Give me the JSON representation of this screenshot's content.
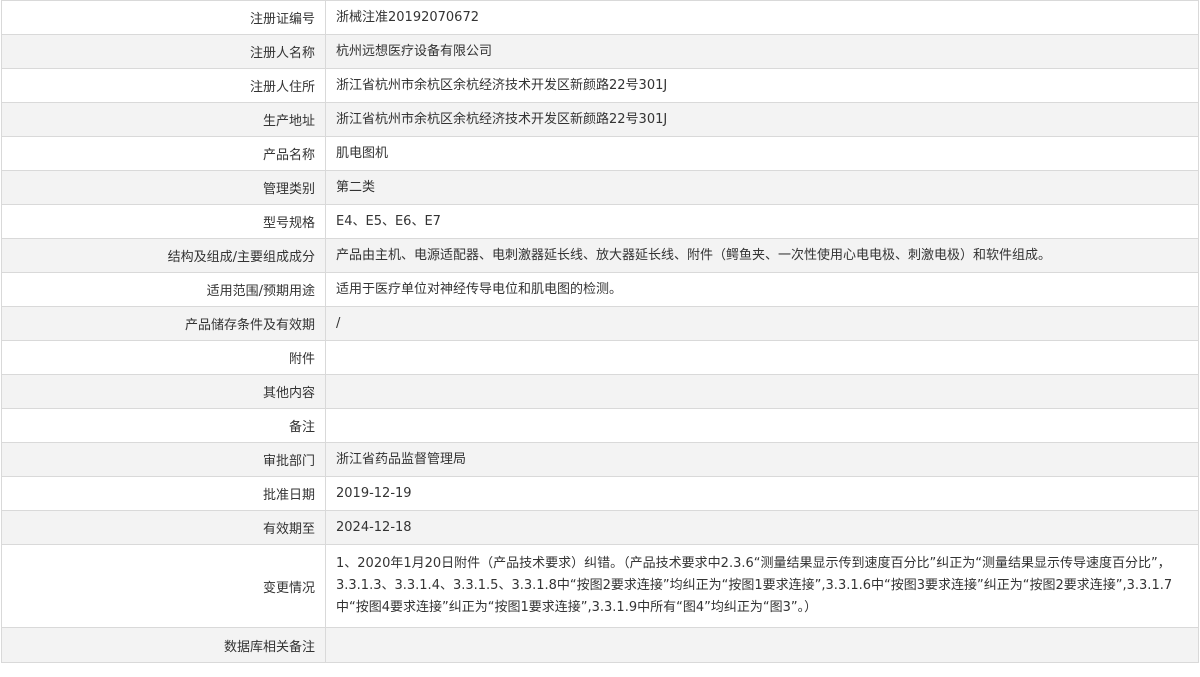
{
  "rows": [
    {
      "label": "注册证编号",
      "value": "浙械注准20192070672"
    },
    {
      "label": "注册人名称",
      "value": "杭州远想医疗设备有限公司"
    },
    {
      "label": "注册人住所",
      "value": "浙江省杭州市余杭区余杭经济技术开发区新颜路22号301J"
    },
    {
      "label": "生产地址",
      "value": "浙江省杭州市余杭区余杭经济技术开发区新颜路22号301J"
    },
    {
      "label": "产品名称",
      "value": "肌电图机"
    },
    {
      "label": "管理类别",
      "value": "第二类"
    },
    {
      "label": "型号规格",
      "value": "E4、E5、E6、E7"
    },
    {
      "label": "结构及组成/主要组成成分",
      "value": "产品由主机、电源适配器、电刺激器延长线、放大器延长线、附件（鳄鱼夹、一次性使用心电电极、刺激电极）和软件组成。"
    },
    {
      "label": "适用范围/预期用途",
      "value": "适用于医疗单位对神经传导电位和肌电图的检测。"
    },
    {
      "label": "产品储存条件及有效期",
      "value": "/"
    },
    {
      "label": "附件",
      "value": ""
    },
    {
      "label": "其他内容",
      "value": ""
    },
    {
      "label": "备注",
      "value": ""
    },
    {
      "label": "审批部门",
      "value": "浙江省药品监督管理局"
    },
    {
      "label": "批准日期",
      "value": "2019-12-19"
    },
    {
      "label": "有效期至",
      "value": "2024-12-18"
    },
    {
      "label": "变更情况",
      "value": "1、2020年1月20日附件（产品技术要求）纠错。（产品技术要求中2.3.6“测量结果显示传到速度百分比”纠正为“测量结果显示传导速度百分比”，3.3.1.3、3.3.1.4、3.3.1.5、3.3.1.8中“按图2要求连接”均纠正为“按图1要求连接”,3.3.1.6中“按图3要求连接”纠正为“按图2要求连接”,3.3.1.7中“按图4要求连接”纠正为“按图1要求连接”,3.3.1.9中所有“图4”均纠正为“图3”。）"
    },
    {
      "label": "数据库相关备注",
      "value": ""
    }
  ]
}
